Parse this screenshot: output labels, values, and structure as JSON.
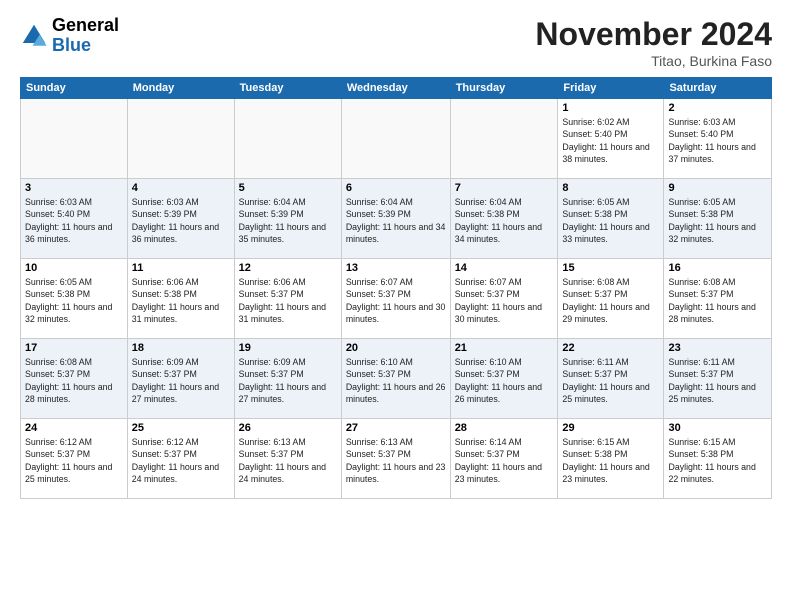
{
  "header": {
    "logo_general": "General",
    "logo_blue": "Blue",
    "month_title": "November 2024",
    "subtitle": "Titao, Burkina Faso"
  },
  "weekdays": [
    "Sunday",
    "Monday",
    "Tuesday",
    "Wednesday",
    "Thursday",
    "Friday",
    "Saturday"
  ],
  "weeks": [
    [
      {
        "day": "",
        "info": ""
      },
      {
        "day": "",
        "info": ""
      },
      {
        "day": "",
        "info": ""
      },
      {
        "day": "",
        "info": ""
      },
      {
        "day": "",
        "info": ""
      },
      {
        "day": "1",
        "info": "Sunrise: 6:02 AM\nSunset: 5:40 PM\nDaylight: 11 hours and 38 minutes."
      },
      {
        "day": "2",
        "info": "Sunrise: 6:03 AM\nSunset: 5:40 PM\nDaylight: 11 hours and 37 minutes."
      }
    ],
    [
      {
        "day": "3",
        "info": "Sunrise: 6:03 AM\nSunset: 5:40 PM\nDaylight: 11 hours and 36 minutes."
      },
      {
        "day": "4",
        "info": "Sunrise: 6:03 AM\nSunset: 5:39 PM\nDaylight: 11 hours and 36 minutes."
      },
      {
        "day": "5",
        "info": "Sunrise: 6:04 AM\nSunset: 5:39 PM\nDaylight: 11 hours and 35 minutes."
      },
      {
        "day": "6",
        "info": "Sunrise: 6:04 AM\nSunset: 5:39 PM\nDaylight: 11 hours and 34 minutes."
      },
      {
        "day": "7",
        "info": "Sunrise: 6:04 AM\nSunset: 5:38 PM\nDaylight: 11 hours and 34 minutes."
      },
      {
        "day": "8",
        "info": "Sunrise: 6:05 AM\nSunset: 5:38 PM\nDaylight: 11 hours and 33 minutes."
      },
      {
        "day": "9",
        "info": "Sunrise: 6:05 AM\nSunset: 5:38 PM\nDaylight: 11 hours and 32 minutes."
      }
    ],
    [
      {
        "day": "10",
        "info": "Sunrise: 6:05 AM\nSunset: 5:38 PM\nDaylight: 11 hours and 32 minutes."
      },
      {
        "day": "11",
        "info": "Sunrise: 6:06 AM\nSunset: 5:38 PM\nDaylight: 11 hours and 31 minutes."
      },
      {
        "day": "12",
        "info": "Sunrise: 6:06 AM\nSunset: 5:37 PM\nDaylight: 11 hours and 31 minutes."
      },
      {
        "day": "13",
        "info": "Sunrise: 6:07 AM\nSunset: 5:37 PM\nDaylight: 11 hours and 30 minutes."
      },
      {
        "day": "14",
        "info": "Sunrise: 6:07 AM\nSunset: 5:37 PM\nDaylight: 11 hours and 30 minutes."
      },
      {
        "day": "15",
        "info": "Sunrise: 6:08 AM\nSunset: 5:37 PM\nDaylight: 11 hours and 29 minutes."
      },
      {
        "day": "16",
        "info": "Sunrise: 6:08 AM\nSunset: 5:37 PM\nDaylight: 11 hours and 28 minutes."
      }
    ],
    [
      {
        "day": "17",
        "info": "Sunrise: 6:08 AM\nSunset: 5:37 PM\nDaylight: 11 hours and 28 minutes."
      },
      {
        "day": "18",
        "info": "Sunrise: 6:09 AM\nSunset: 5:37 PM\nDaylight: 11 hours and 27 minutes."
      },
      {
        "day": "19",
        "info": "Sunrise: 6:09 AM\nSunset: 5:37 PM\nDaylight: 11 hours and 27 minutes."
      },
      {
        "day": "20",
        "info": "Sunrise: 6:10 AM\nSunset: 5:37 PM\nDaylight: 11 hours and 26 minutes."
      },
      {
        "day": "21",
        "info": "Sunrise: 6:10 AM\nSunset: 5:37 PM\nDaylight: 11 hours and 26 minutes."
      },
      {
        "day": "22",
        "info": "Sunrise: 6:11 AM\nSunset: 5:37 PM\nDaylight: 11 hours and 25 minutes."
      },
      {
        "day": "23",
        "info": "Sunrise: 6:11 AM\nSunset: 5:37 PM\nDaylight: 11 hours and 25 minutes."
      }
    ],
    [
      {
        "day": "24",
        "info": "Sunrise: 6:12 AM\nSunset: 5:37 PM\nDaylight: 11 hours and 25 minutes."
      },
      {
        "day": "25",
        "info": "Sunrise: 6:12 AM\nSunset: 5:37 PM\nDaylight: 11 hours and 24 minutes."
      },
      {
        "day": "26",
        "info": "Sunrise: 6:13 AM\nSunset: 5:37 PM\nDaylight: 11 hours and 24 minutes."
      },
      {
        "day": "27",
        "info": "Sunrise: 6:13 AM\nSunset: 5:37 PM\nDaylight: 11 hours and 23 minutes."
      },
      {
        "day": "28",
        "info": "Sunrise: 6:14 AM\nSunset: 5:37 PM\nDaylight: 11 hours and 23 minutes."
      },
      {
        "day": "29",
        "info": "Sunrise: 6:15 AM\nSunset: 5:38 PM\nDaylight: 11 hours and 23 minutes."
      },
      {
        "day": "30",
        "info": "Sunrise: 6:15 AM\nSunset: 5:38 PM\nDaylight: 11 hours and 22 minutes."
      }
    ]
  ]
}
